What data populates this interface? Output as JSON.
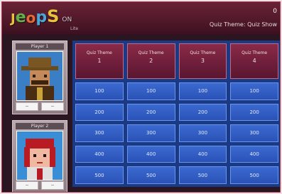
{
  "header": {
    "logo_letters": [
      "J",
      "e",
      "o",
      "p",
      "S"
    ],
    "logo_suffix": "ON",
    "logo_sub": "Lite",
    "top_right_number": "0",
    "status_text": "Quiz Theme: Quiz Show"
  },
  "players": [
    {
      "name": "Player 1",
      "buttons": [
        "--",
        "--"
      ],
      "avatar": "cowboy-avatar"
    },
    {
      "name": "Player 2",
      "buttons": [
        "--",
        "--"
      ],
      "avatar": "red-hair-avatar"
    }
  ],
  "board": {
    "categories": [
      {
        "label": "Quiz Theme",
        "number": "1"
      },
      {
        "label": "Quiz Theme",
        "number": "2"
      },
      {
        "label": "Quiz Theme",
        "number": "3"
      },
      {
        "label": "Quiz Theme",
        "number": "4"
      }
    ],
    "rows": [
      [
        "100",
        "100",
        "100",
        "100"
      ],
      [
        "200",
        "200",
        "200",
        "200"
      ],
      [
        "300",
        "300",
        "300",
        "300"
      ],
      [
        "400",
        "400",
        "400",
        "400"
      ],
      [
        "500",
        "500",
        "500",
        "500"
      ]
    ]
  },
  "colors": {
    "topbar": "#4a1626",
    "category": "#7a2440",
    "cell": "#3c6ad0",
    "board": "#1a3a86"
  }
}
